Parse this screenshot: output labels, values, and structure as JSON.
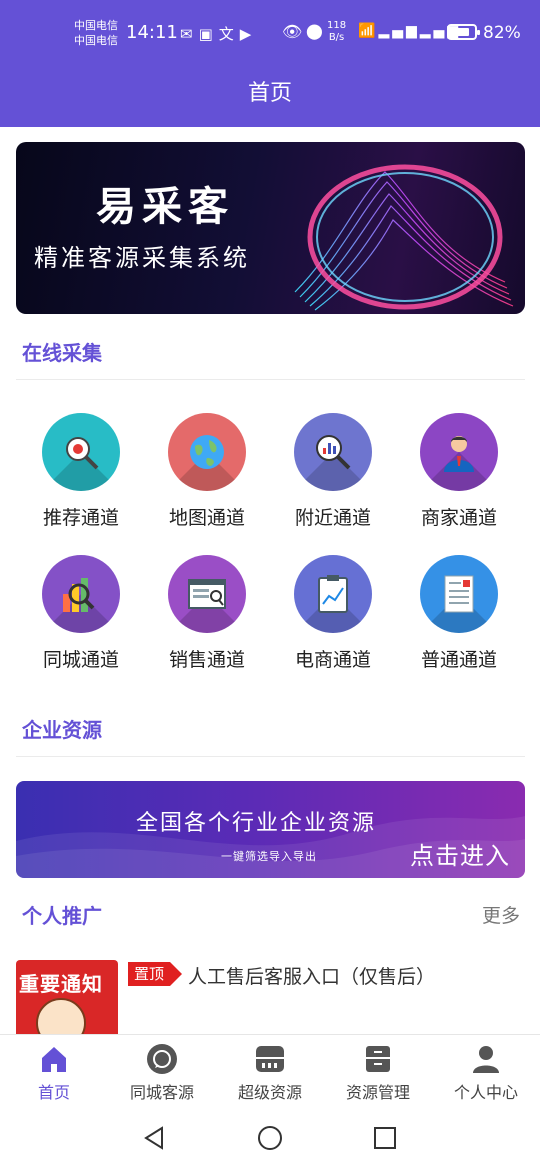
{
  "status": {
    "carrier1": "中国电信",
    "carrier2": "中国电信",
    "time": "14:11",
    "net_speed_value": "118",
    "net_speed_unit": "B/s",
    "battery_percent": "82%",
    "battery_level": 0.82
  },
  "header": {
    "title": "首页"
  },
  "banner": {
    "title": "易采客",
    "subtitle": "精准客源采集系统"
  },
  "online": {
    "title": "在线采集",
    "channels": [
      {
        "label": "推荐通道",
        "color": "#28bcc6",
        "icon": "ladybug-magnifier-icon"
      },
      {
        "label": "地图通道",
        "color": "#e46a6a",
        "icon": "globe-icon"
      },
      {
        "label": "附近通道",
        "color": "#6e75cf",
        "icon": "chart-magnifier-icon"
      },
      {
        "label": "商家通道",
        "color": "#8c46c4",
        "icon": "business-person-icon"
      },
      {
        "label": "同城通道",
        "color": "#8451c7",
        "icon": "bar-chart-magnifier-icon"
      },
      {
        "label": "销售通道",
        "color": "#9a4ec6",
        "icon": "browser-search-icon"
      },
      {
        "label": "电商通道",
        "color": "#6670d4",
        "icon": "clipboard-chart-icon"
      },
      {
        "label": "普通通道",
        "color": "#3591e6",
        "icon": "document-icon"
      }
    ]
  },
  "enterprise": {
    "title": "企业资源",
    "banner_title": "全国各个行业企业资源",
    "banner_sub": "一键筛选导入导出",
    "banner_enter": "点击进入"
  },
  "promo": {
    "title": "个人推广",
    "more": "更多",
    "thumb_text": "重要通知",
    "badge": "置顶",
    "item_title": "人工售后客服入口（仅售后）"
  },
  "tabs": [
    {
      "label": "首页",
      "icon": "home-icon",
      "active": true
    },
    {
      "label": "同城客源",
      "icon": "chat-bubble-icon",
      "active": false
    },
    {
      "label": "超级资源",
      "icon": "server-icon",
      "active": false
    },
    {
      "label": "资源管理",
      "icon": "cabinet-icon",
      "active": false
    },
    {
      "label": "个人中心",
      "icon": "person-icon",
      "active": false
    }
  ],
  "colors": {
    "primary": "#6451d6",
    "badge_red": "#e02020"
  }
}
